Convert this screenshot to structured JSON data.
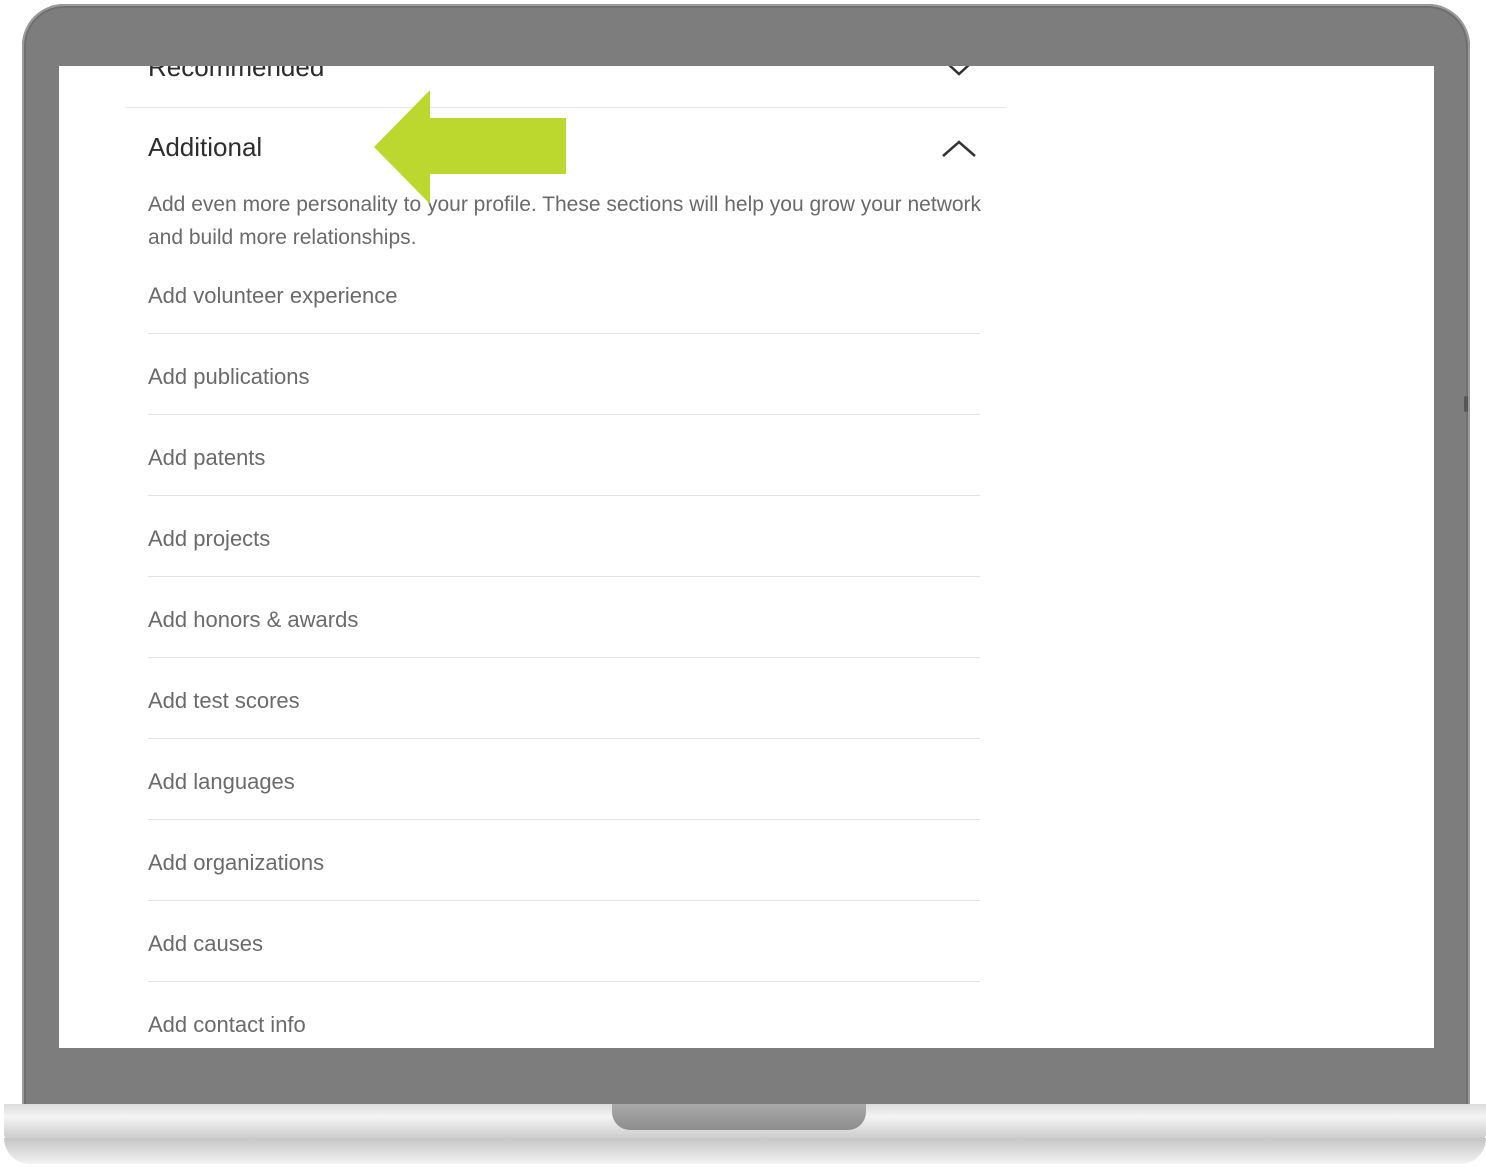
{
  "panel": {
    "recommended_label": "Recommended",
    "additional_title": "Additional",
    "description": "Add even more personality to your profile. These sections will help you grow your network and build more relationships.",
    "items": [
      {
        "label": "Add volunteer experience"
      },
      {
        "label": "Add publications"
      },
      {
        "label": "Add patents"
      },
      {
        "label": "Add projects"
      },
      {
        "label": "Add honors & awards"
      },
      {
        "label": "Add test scores"
      },
      {
        "label": "Add languages"
      },
      {
        "label": "Add organizations"
      },
      {
        "label": "Add causes"
      },
      {
        "label": "Add contact info"
      }
    ]
  },
  "icons": {
    "collapse": "chevron-up-icon",
    "expand": "chevron-down-icon",
    "pointer": "arrow-left-icon"
  },
  "colors": {
    "arrow": "#bcd82e",
    "bezel": "#7d7d7d",
    "text_muted": "#6a6a6a",
    "text_title": "#2d2d2d"
  }
}
